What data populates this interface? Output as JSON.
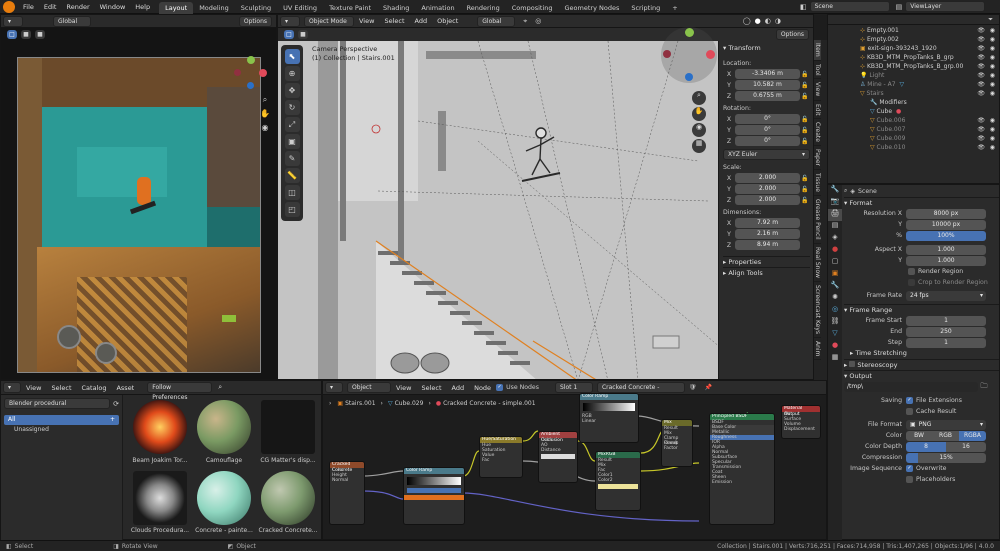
{
  "menu": {
    "items": [
      "File",
      "Edit",
      "Render",
      "Window",
      "Help"
    ]
  },
  "workspaces": [
    "Layout",
    "Modeling",
    "Sculpting",
    "UV Editing",
    "Texture Paint",
    "Shading",
    "Animation",
    "Rendering",
    "Compositing",
    "Geometry Nodes",
    "Scripting"
  ],
  "scene": {
    "name": "Scene",
    "view_layer": "ViewLayer"
  },
  "left_view": {
    "transform": "Global",
    "options": "Options"
  },
  "viewport": {
    "mode": "Object Mode",
    "menus": [
      "View",
      "Select",
      "Add",
      "Object"
    ],
    "transform": "Global",
    "options": "Options",
    "overlay_title": "Camera Perspective",
    "overlay_sub": "(1) Collection | Stairs.001"
  },
  "n_panel": {
    "transform_title": "Transform",
    "location_label": "Location:",
    "location": {
      "x": "-3.3406 m",
      "y": "10.582 m",
      "z": "0.6755 m"
    },
    "rotation_label": "Rotation:",
    "rotation": {
      "x": "0°",
      "y": "0°",
      "z": "0°"
    },
    "rotation_mode": "XYZ Euler",
    "scale_label": "Scale:",
    "scale": {
      "x": "2.000",
      "y": "2.000",
      "z": "2.000"
    },
    "dimensions_label": "Dimensions:",
    "dimensions": {
      "x": "7.92 m",
      "y": "2.16 m",
      "z": "8.94 m"
    },
    "properties": "Properties",
    "align_tools": "Align Tools",
    "axis_letters": [
      "X",
      "Y",
      "Z"
    ]
  },
  "side_tabs": [
    "Item",
    "Tool",
    "View",
    "Edit",
    "Create",
    "Paper",
    "Tissue",
    "Grease Pencil",
    "Real Snow",
    "Screencast Keys",
    "Anim"
  ],
  "outliner": {
    "items": [
      {
        "name": "Empty.001",
        "indent": 1
      },
      {
        "name": "Empty.002",
        "indent": 1
      },
      {
        "name": "exit-sign-393243_1920",
        "indent": 1
      },
      {
        "name": "KB3D_MTM_PropTanks_B_grp",
        "indent": 1
      },
      {
        "name": "KB3D_MTM_PropTanks_B_grp.00",
        "indent": 1
      },
      {
        "name": "Light",
        "indent": 1
      },
      {
        "name": "Mine - A7",
        "indent": 1
      },
      {
        "name": "Stairs",
        "indent": 1
      },
      {
        "name": "Modifiers",
        "indent": 2
      },
      {
        "name": "Cube",
        "indent": 2
      },
      {
        "name": "Cube.006",
        "indent": 2
      },
      {
        "name": "Cube.007",
        "indent": 2
      },
      {
        "name": "Cube.009",
        "indent": 2
      },
      {
        "name": "Cube.010",
        "indent": 2
      }
    ]
  },
  "properties": {
    "object_name": "Scene",
    "format_title": "Format",
    "resolution_x_label": "Resolution X",
    "resolution_x": "8000 px",
    "y_label": "Y",
    "resolution_y": "10000 px",
    "pct_label": "%",
    "resolution_pct": "100%",
    "aspect_x_label": "Aspect X",
    "aspect_x": "1.000",
    "aspect_y_label": "Y",
    "aspect_y": "1.000",
    "render_region": "Render Region",
    "crop": "Crop to Render Region",
    "frame_rate_label": "Frame Rate",
    "frame_rate": "24 fps",
    "frame_range_title": "Frame Range",
    "frame_start_label": "Frame Start",
    "frame_start": "1",
    "end_label": "End",
    "frame_end": "250",
    "step_label": "Step",
    "frame_step": "1",
    "time_stretching": "Time Stretching",
    "stereoscopy": "Stereoscopy",
    "output_title": "Output",
    "output_path": "/tmp\\",
    "saving_label": "Saving",
    "file_ext": "File Extensions",
    "cache_result": "Cache Result",
    "file_format_label": "File Format",
    "file_format": "PNG",
    "color_label": "Color",
    "color_bw": "BW",
    "color_rgb": "RGB",
    "color_rgba": "RGBA",
    "color_depth_label": "Color Depth",
    "depth_8": "8",
    "depth_16": "16",
    "compression_label": "Compression",
    "compression": "15%",
    "image_seq_label": "Image Sequence",
    "overwrite": "Overwrite",
    "placeholders": "Placeholders"
  },
  "asset_browser": {
    "menus": [
      "View",
      "Select",
      "Catalog",
      "Asset"
    ],
    "filter": "Follow Preferences",
    "library": "Blender procedural",
    "catalogs": [
      "All",
      "Unassigned"
    ],
    "assets": [
      {
        "name": "Beam Joakim Tor...",
        "color": "#e04a1a"
      },
      {
        "name": "Camouflage",
        "color": "#7a9a63"
      },
      {
        "name": "CG Matter's disp...",
        "color": "#1a1a1a"
      },
      {
        "name": "Clouds Procedura...",
        "color": "#cccccc"
      },
      {
        "name": "Concrete - painte...",
        "color": "#8fd6c0"
      },
      {
        "name": "Cracked Concrete...",
        "color": "#7d9a6e"
      }
    ]
  },
  "node_editor": {
    "editor_type": "Object",
    "menus": [
      "View",
      "Select",
      "Add",
      "Node"
    ],
    "use_nodes": "Use Nodes",
    "slot": "Slot 1",
    "material": "Cracked Concrete - simple.001",
    "breadcrumb": [
      "Stairs.001",
      "Cube.029",
      "Cracked Concrete - simple.001"
    ]
  },
  "status": {
    "left": [
      "Select",
      "Rotate View",
      "Object"
    ],
    "stats": "Collection | Stairs.001 | Verts:716,251 | Faces:714,958 | Tris:1,407,265 | Objects:1/96 | 4.0.0"
  }
}
